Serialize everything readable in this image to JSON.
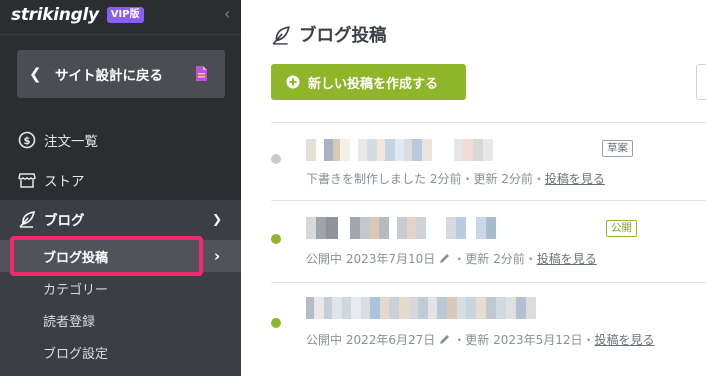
{
  "app": {
    "logo": "strikingly",
    "plan_badge": "VIP版"
  },
  "sidebar": {
    "back_label": "サイト設計に戻る",
    "items": [
      {
        "label": "注文一覧",
        "icon": "dollar-circle-icon"
      },
      {
        "label": "ストア",
        "icon": "store-icon"
      },
      {
        "label": "ブログ",
        "icon": "quill-icon"
      }
    ],
    "blog_sub": [
      {
        "label": "ブログ投稿"
      },
      {
        "label": "カテゴリー"
      },
      {
        "label": "読者登録"
      },
      {
        "label": "ブログ設定"
      }
    ],
    "highlight_color": "#f02a6c"
  },
  "main": {
    "title": "ブログ投稿",
    "create_button": "新しい投稿を作成する",
    "posts": [
      {
        "status": "草案",
        "status_color": "#9aa0a6",
        "meta_prefix": "下書きを制作しました 2分前・更新 2分前・",
        "view_link": "投稿を見る"
      },
      {
        "status": "公開",
        "status_color": "#8fb52b",
        "meta_prefix": "公開中 2023年7月10日",
        "meta_suffix": "・更新 2分前・",
        "view_link": "投稿を見る"
      },
      {
        "status_color": "#8fb52b",
        "meta_prefix": "公開中 2022年6月27日",
        "meta_suffix": "・更新 2023年5月12日・",
        "view_link": "投稿を見る"
      }
    ]
  },
  "colors": {
    "sidebar_bg": "#2b2d30",
    "accent_green": "#8fb52b",
    "vip_purple": "#8b5cf6"
  }
}
